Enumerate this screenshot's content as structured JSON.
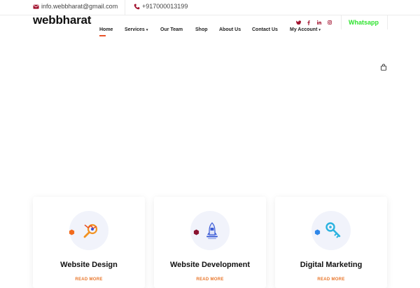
{
  "topbar": {
    "email": "info.webbharat@gmail.com",
    "phone": "+917000013199"
  },
  "header": {
    "logo": "webbharat",
    "whatsapp_label": "Whatsapp"
  },
  "nav": {
    "items": [
      {
        "label": "Home",
        "active": true
      },
      {
        "label": "Services",
        "dropdown": true
      },
      {
        "label": "Our Team"
      },
      {
        "label": "Shop"
      },
      {
        "label": "About Us"
      },
      {
        "label": "Contact Us"
      },
      {
        "label": "My Account",
        "dropdown": true
      }
    ],
    "dropdown_caret": "▾"
  },
  "social": [
    "twitter-icon",
    "facebook-icon",
    "linkedin-icon",
    "instagram-icon"
  ],
  "cards": [
    {
      "title": "Website Design",
      "readmore": "READ MORE",
      "icon": "design-tools-icon"
    },
    {
      "title": "Website Development",
      "readmore": "READ MORE",
      "icon": "rocket-icon"
    },
    {
      "title": "Digital Marketing",
      "readmore": "READ MORE",
      "icon": "key-icon"
    }
  ],
  "colors": {
    "brand": "#a31531",
    "accent": "#e8542a",
    "readmore": "#e8762a",
    "whatsapp": "#2ee32e",
    "card_icon_bg": "#f1f3fb"
  }
}
